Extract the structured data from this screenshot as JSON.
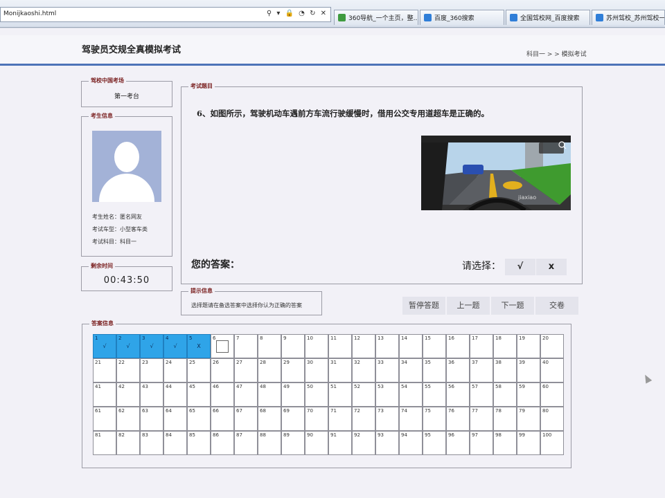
{
  "browser": {
    "address": "Monijkaoshi.html",
    "address_icons": "⚲ ▾ 🔒 ◔ ↻ ✕",
    "tabs": [
      {
        "label": "360导航_一个主页，整...",
        "color": "#3f9b3f"
      },
      {
        "label": "百度_360搜索",
        "color": "#2f7ed8"
      },
      {
        "label": "全国驾校网_百度搜索",
        "color": "#2f7ed8"
      },
      {
        "label": "苏州驾校_苏州驾校一点",
        "color": "#2f7ed8"
      }
    ],
    "close_glyph": "✕"
  },
  "header": {
    "title": "驾驶员交规全真模拟考试",
    "breadcrumb": "科目一 > > 模拟考试"
  },
  "station": {
    "legend": "驾校中国考场",
    "name": "第一考台"
  },
  "student": {
    "legend": "考生信息",
    "name": "考生姓名：匿名网友",
    "car_type": "考试车型：小型客车类",
    "subject": "考试科目：科目一"
  },
  "timer": {
    "legend": "剩余时间",
    "value": "00:43:50"
  },
  "question": {
    "legend": "考试题目",
    "text": "6、如图所示，驾驶机动车遇前方车流行驶缓慢时，借用公交专用道超车是正确的。",
    "image_alt": "在驾驶座内望向前方道路的图片",
    "image_watermark": "jiaxiao",
    "your_answer_label": "您的答案：",
    "choose_label": "请选择：",
    "choices": [
      "√",
      "x"
    ]
  },
  "tips": {
    "legend": "提示信息",
    "text": "选择题请在备选答案中选择你认为正确的答案"
  },
  "nav": {
    "pause": "暂停答题",
    "prev": "上一题",
    "next": "下一题",
    "submit": "交卷"
  },
  "answers": {
    "legend": "答案信息",
    "cells": [
      {
        "num": "1",
        "mark": "√",
        "done": true
      },
      {
        "num": "2",
        "mark": "√",
        "done": true
      },
      {
        "num": "3",
        "mark": "√",
        "done": true
      },
      {
        "num": "4",
        "mark": "√",
        "done": true
      },
      {
        "num": "5",
        "mark": "X",
        "done": true
      },
      {
        "num": "6",
        "current": true
      },
      {
        "num": "7"
      },
      {
        "num": "8"
      },
      {
        "num": "9"
      },
      {
        "num": "10"
      },
      {
        "num": "11"
      },
      {
        "num": "12"
      },
      {
        "num": "13"
      },
      {
        "num": "14"
      },
      {
        "num": "15"
      },
      {
        "num": "16"
      },
      {
        "num": "17"
      },
      {
        "num": "18"
      },
      {
        "num": "19"
      },
      {
        "num": "20"
      },
      {
        "num": "21"
      },
      {
        "num": "22"
      },
      {
        "num": "23"
      },
      {
        "num": "24"
      },
      {
        "num": "25"
      },
      {
        "num": "26"
      },
      {
        "num": "27"
      },
      {
        "num": "28"
      },
      {
        "num": "29"
      },
      {
        "num": "30"
      },
      {
        "num": "31"
      },
      {
        "num": "32"
      },
      {
        "num": "33"
      },
      {
        "num": "34"
      },
      {
        "num": "35"
      },
      {
        "num": "36"
      },
      {
        "num": "37"
      },
      {
        "num": "38"
      },
      {
        "num": "39"
      },
      {
        "num": "40"
      },
      {
        "num": "41"
      },
      {
        "num": "42"
      },
      {
        "num": "43"
      },
      {
        "num": "44"
      },
      {
        "num": "45"
      },
      {
        "num": "46"
      },
      {
        "num": "47"
      },
      {
        "num": "48"
      },
      {
        "num": "49"
      },
      {
        "num": "50"
      },
      {
        "num": "51"
      },
      {
        "num": "52"
      },
      {
        "num": "53"
      },
      {
        "num": "54"
      },
      {
        "num": "55"
      },
      {
        "num": "56"
      },
      {
        "num": "57"
      },
      {
        "num": "58"
      },
      {
        "num": "59"
      },
      {
        "num": "60"
      },
      {
        "num": "61"
      },
      {
        "num": "62"
      },
      {
        "num": "63"
      },
      {
        "num": "64"
      },
      {
        "num": "65"
      },
      {
        "num": "66"
      },
      {
        "num": "67"
      },
      {
        "num": "68"
      },
      {
        "num": "69"
      },
      {
        "num": "70"
      },
      {
        "num": "71"
      },
      {
        "num": "72"
      },
      {
        "num": "73"
      },
      {
        "num": "74"
      },
      {
        "num": "75"
      },
      {
        "num": "76"
      },
      {
        "num": "77"
      },
      {
        "num": "78"
      },
      {
        "num": "79"
      },
      {
        "num": "80"
      },
      {
        "num": "81"
      },
      {
        "num": "82"
      },
      {
        "num": "83"
      },
      {
        "num": "84"
      },
      {
        "num": "85"
      },
      {
        "num": "86"
      },
      {
        "num": "87"
      },
      {
        "num": "88"
      },
      {
        "num": "89"
      },
      {
        "num": "90"
      },
      {
        "num": "91"
      },
      {
        "num": "92"
      },
      {
        "num": "93"
      },
      {
        "num": "94"
      },
      {
        "num": "95"
      },
      {
        "num": "96"
      },
      {
        "num": "97"
      },
      {
        "num": "98"
      },
      {
        "num": "99"
      },
      {
        "num": "100"
      }
    ]
  },
  "colors": {
    "answered": "#2fa4e8",
    "header_rule": "#4d73b8",
    "legend_text": "#7a2020"
  }
}
